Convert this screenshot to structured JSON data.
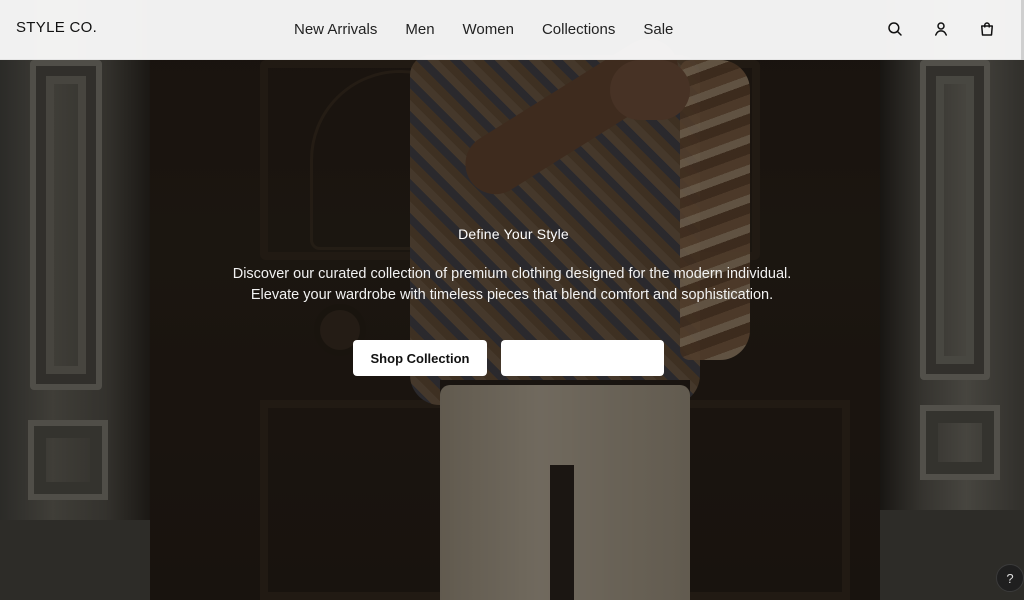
{
  "brand": "STYLE CO.",
  "nav": {
    "links": [
      {
        "label": "New Arrivals"
      },
      {
        "label": "Men"
      },
      {
        "label": "Women"
      },
      {
        "label": "Collections"
      },
      {
        "label": "Sale"
      }
    ],
    "icons": [
      "search-icon",
      "user-icon",
      "shopping-bag-icon"
    ]
  },
  "hero": {
    "title": "Define Your Style",
    "description_line1": "Discover our curated collection of premium clothing designed for the modern individual.",
    "description_line2": "Elevate your wardrobe with timeless pieces that blend comfort and sophistication.",
    "primary_button": "Shop Collection",
    "secondary_button": ""
  },
  "help": {
    "label": "?"
  },
  "colors": {
    "navbar_bg": "#f8f8f8",
    "button_bg": "#ffffff",
    "text_on_hero": "#ffffff"
  }
}
